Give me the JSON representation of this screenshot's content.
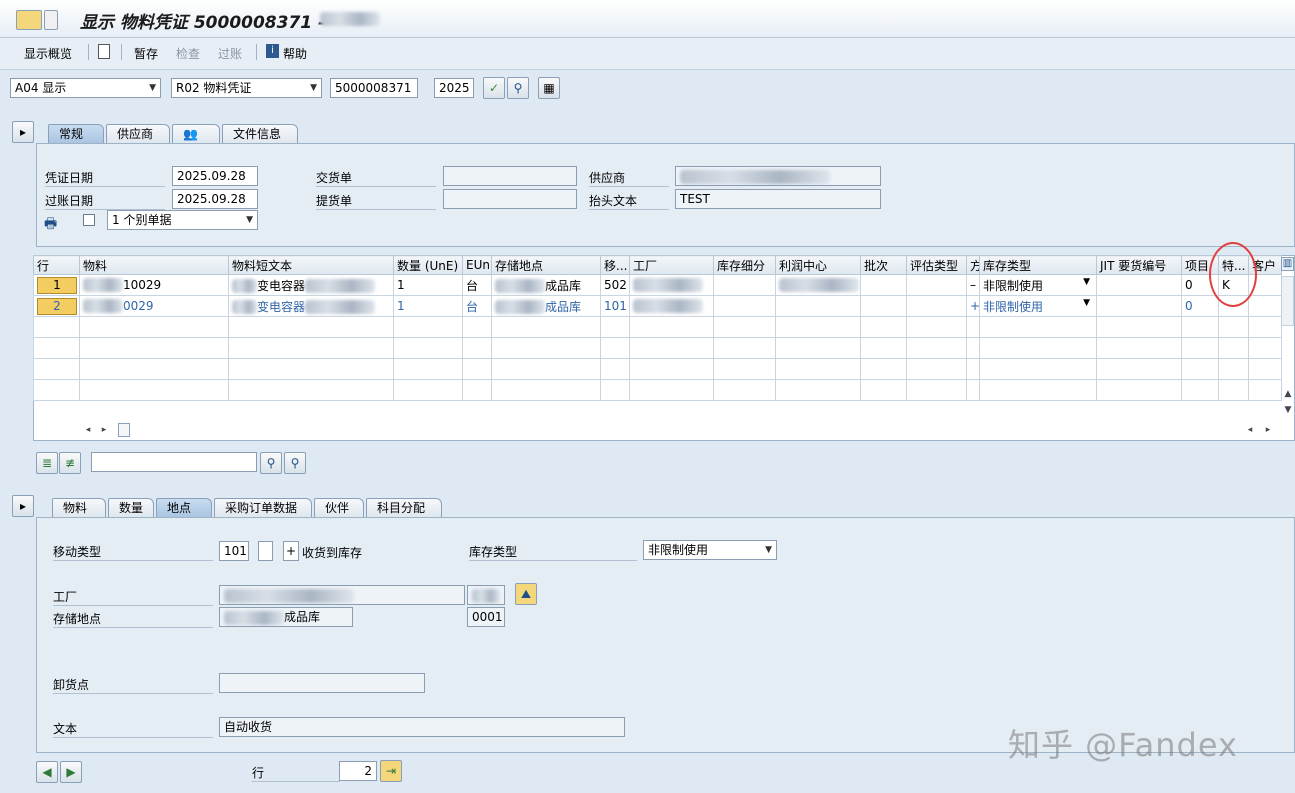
{
  "window": {
    "title": "显示 物料凭证 5000008371 - "
  },
  "toolbar": {
    "overview": "显示概览",
    "hold": "暂存",
    "check": "检查",
    "post": "过账",
    "help": "帮助"
  },
  "selectors": {
    "action": "A04 显示",
    "reference": "R02 物料凭证",
    "doc_number": "5000008371",
    "year": "2025"
  },
  "header_tabs": [
    "常规",
    "供应商",
    "",
    "文件信息"
  ],
  "header": {
    "doc_date_label": "凭证日期",
    "doc_date": "2025.09.28",
    "post_date_label": "过账日期",
    "post_date": "2025.09.28",
    "delivery_note_label": "交货单",
    "bill_of_lading_label": "提货单",
    "vendor_label": "供应商",
    "header_text_label": "抬头文本",
    "header_text": "TEST",
    "slip_option": "1 个别单据"
  },
  "grid": {
    "columns": [
      "行",
      "物料",
      "物料短文本",
      "数量 (UnE)",
      "EUn",
      "存储地点",
      "移...",
      "工厂",
      "库存细分",
      "利润中心",
      "批次",
      "评估类型",
      "方",
      "库存类型",
      "JIT 要货编号",
      "项目",
      "特...",
      "客户"
    ],
    "rows": [
      {
        "line": "1",
        "material": "10029",
        "short_text": "变电容器",
        "qty": "1",
        "eun": "台",
        "sloc": "成品库",
        "mvt": "502",
        "plant": "",
        "sign": "–",
        "stock_type": "非限制使用",
        "item": "0",
        "special": "K"
      },
      {
        "line": "2",
        "material": "0029",
        "short_text": "变电容器",
        "qty": "1",
        "eun": "台",
        "sloc": "成品库",
        "mvt": "101",
        "plant": "",
        "sign": "+",
        "stock_type": "非限制使用",
        "item": "0",
        "special": ""
      }
    ]
  },
  "detail_tabs": [
    "物料",
    "数量",
    "地点",
    "采购订单数据",
    "伙伴",
    "科目分配"
  ],
  "detail": {
    "mvt_type_label": "移动类型",
    "mvt_type": "101",
    "mvt_sign": "+",
    "mvt_text": "收货到库存",
    "stock_type_label": "库存类型",
    "stock_type": "非限制使用",
    "plant_label": "工厂",
    "sloc_label": "存储地点",
    "sloc_text": "成品库",
    "sloc_code": "0001",
    "unloading_label": "卸货点",
    "text_label": "文本",
    "text_value": "自动收货"
  },
  "footer": {
    "row_label": "行",
    "row_value": "2"
  },
  "watermark": "知乎 @Fandex"
}
